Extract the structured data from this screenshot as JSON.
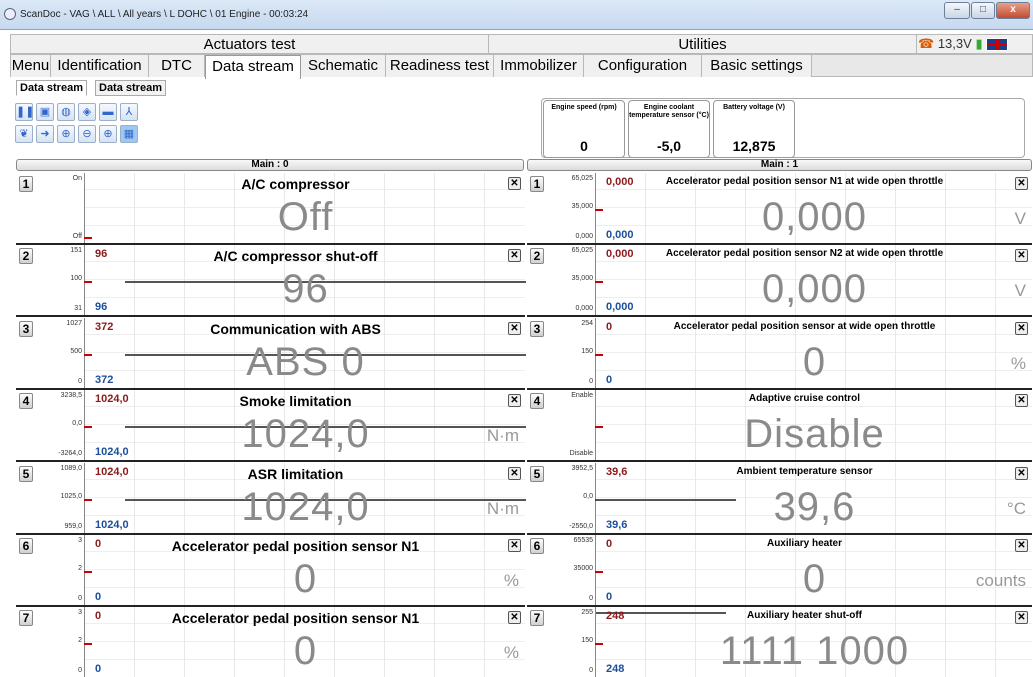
{
  "window": {
    "title": "ScanDoc - VAG \\ ALL \\ All years \\ L DOHC \\ 01 Engine - 00:03:24",
    "btn_min": "–",
    "btn_max": "□",
    "btn_close": "x"
  },
  "top_tabs": {
    "actuators": "Actuators test",
    "utilities": "Utilities"
  },
  "status": {
    "voltage": "13,3V",
    "phone_icon": "phone-icon",
    "battery_icon": "plug-icon",
    "flag_icon": "uk-flag-icon"
  },
  "tabs": [
    "Menu",
    "Identification",
    "DTC",
    "Data stream",
    "Schematic",
    "Readiness test",
    "Immobilizer",
    "Configuration",
    "Basic settings"
  ],
  "subtabs": [
    "Data stream",
    "Data stream"
  ],
  "toolbar_icons": [
    "pause-icon",
    "save-icon",
    "record-icon",
    "play-icon",
    "folder-icon",
    "tree-icon",
    "leaf-icon",
    "export-icon",
    "zoom-in-icon",
    "zoom-out-icon",
    "zoom-fit-icon",
    "grid-icon"
  ],
  "gauges": [
    {
      "label": "Engine speed (rpm)",
      "value": "0"
    },
    {
      "label": "Engine coolant temperature sensor (°C)",
      "value": "-5,0"
    },
    {
      "label": "Battery voltage (V)",
      "value": "12,875"
    }
  ],
  "main0": {
    "header": "Main : 0",
    "panels": [
      {
        "num": "1",
        "title": "A/C compressor",
        "value": "Off",
        "unit": "",
        "top": "",
        "bot": "",
        "ax": [
          "On",
          "",
          "Off"
        ]
      },
      {
        "num": "2",
        "title": "A/C compressor shut-off",
        "value": "96",
        "unit": "",
        "top": "96",
        "bot": "96",
        "ax": [
          "151",
          "100",
          "31"
        ]
      },
      {
        "num": "3",
        "title": "Communication with ABS",
        "value": "ABS 0",
        "unit": "",
        "top": "372",
        "bot": "372",
        "ax": [
          "1027",
          "500",
          "0"
        ]
      },
      {
        "num": "4",
        "title": "Smoke limitation",
        "value": "1024,0",
        "unit": "N·m",
        "top": "1024,0",
        "bot": "1024,0",
        "ax": [
          "3238,5",
          "0,0",
          "-3264,0"
        ]
      },
      {
        "num": "5",
        "title": "ASR limitation",
        "value": "1024,0",
        "unit": "N·m",
        "top": "1024,0",
        "bot": "1024,0",
        "ax": [
          "1089,0",
          "1025,0",
          "959,0"
        ]
      },
      {
        "num": "6",
        "title": "Accelerator pedal position sensor N1",
        "value": "0",
        "unit": "%",
        "top": "0",
        "bot": "0",
        "ax": [
          "3",
          "2",
          "0"
        ]
      },
      {
        "num": "7",
        "title": "Accelerator pedal position sensor N1",
        "value": "0",
        "unit": "%",
        "top": "0",
        "bot": "0",
        "ax": [
          "3",
          "2",
          "0"
        ]
      }
    ]
  },
  "main1": {
    "header": "Main : 1",
    "panels": [
      {
        "num": "1",
        "title": "Accelerator pedal position sensor N1 at wide open throttle",
        "value": "0,000",
        "unit": "V",
        "top": "0,000",
        "bot": "0,000",
        "ax": [
          "65,025",
          "35,000",
          "0,000"
        ]
      },
      {
        "num": "2",
        "title": "Accelerator pedal position sensor N2 at wide open throttle",
        "value": "0,000",
        "unit": "V",
        "top": "0,000",
        "bot": "0,000",
        "ax": [
          "65,025",
          "35,000",
          "0,000"
        ]
      },
      {
        "num": "3",
        "title": "Accelerator pedal position sensor at wide open throttle",
        "value": "0",
        "unit": "%",
        "top": "0",
        "bot": "0",
        "ax": [
          "254",
          "150",
          "0"
        ]
      },
      {
        "num": "4",
        "title": "Adaptive cruise control",
        "value": "Disable",
        "unit": "",
        "top": "",
        "bot": "",
        "ax": [
          "Enable",
          "",
          "Disable"
        ]
      },
      {
        "num": "5",
        "title": "Ambient temperature sensor",
        "value": "39,6",
        "unit": "°C",
        "top": "39,6",
        "bot": "39,6",
        "ax": [
          "3952,5",
          "0,0",
          "-2550,0"
        ]
      },
      {
        "num": "6",
        "title": "Auxiliary heater",
        "value": "0",
        "unit": "counts",
        "top": "0",
        "bot": "0",
        "ax": [
          "65535",
          "35000",
          "0"
        ]
      },
      {
        "num": "7",
        "title": "Auxiliary heater shut-off",
        "value": "1111 1000",
        "unit": "",
        "top": "248",
        "bot": "248",
        "ax": [
          "255",
          "150",
          "0"
        ]
      }
    ]
  }
}
